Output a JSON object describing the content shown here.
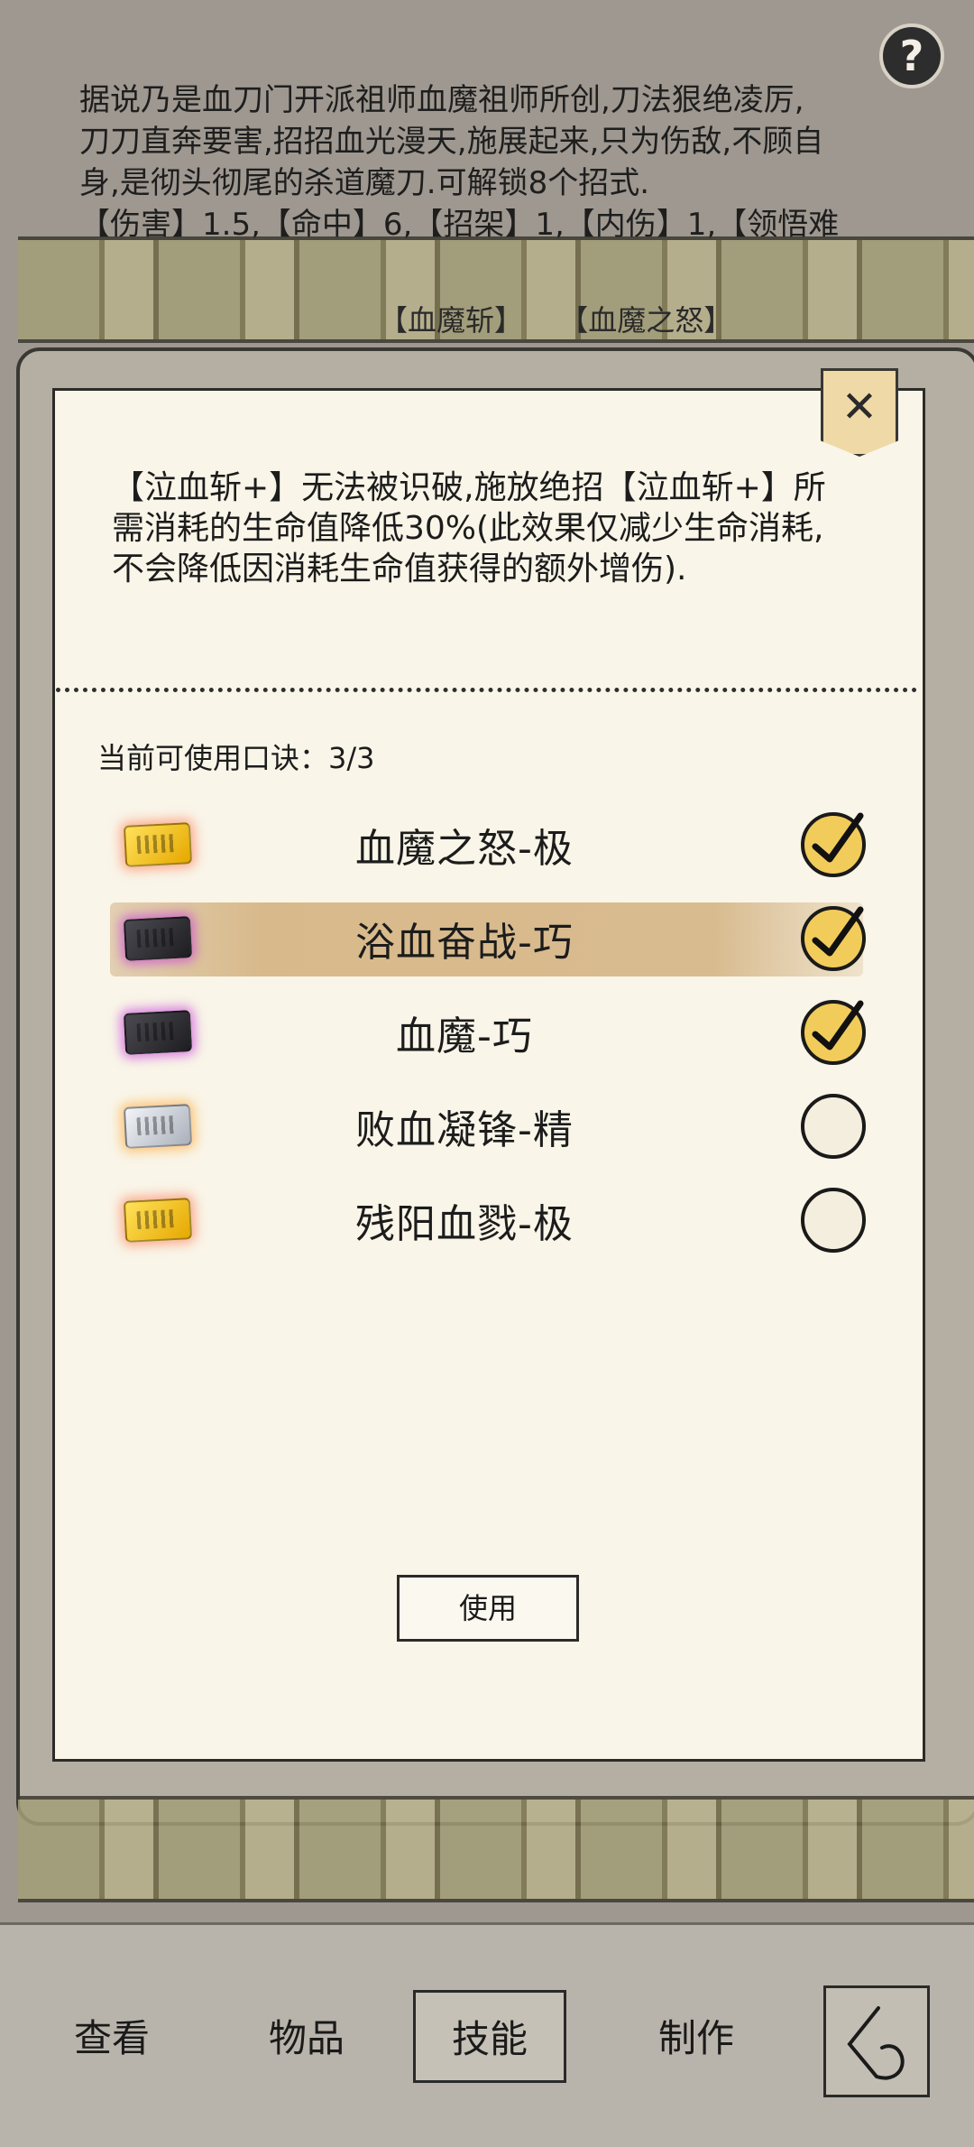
{
  "description": {
    "line1": "据说乃是血刀门开派祖师血魔祖师所创,刀法狠绝凌厉,",
    "line2": "刀刀直奔要害,招招血光漫天,施展起来,只为伤敌,不顾自",
    "line3": "身,是彻头彻尾的杀道魔刀.可解锁8个招式.",
    "line4": "【伤害】1.5,【命中】6,【招架】1,【内伤】1,【领悟难"
  },
  "help_label": "?",
  "hidden_skills": [
    "【血魔斩】",
    "【血魔之怒】"
  ],
  "popup": {
    "close_label": "✕",
    "effect_text": "【泣血斩+】无法被识破,施放绝招【泣血斩+】所需消耗的生命值降低30%(此效果仅减少生命消耗,不会降低因消耗生命值获得的额外增伤).",
    "usable_label": "当前可使用口诀：3/3",
    "items": [
      {
        "name": "血魔之怒-极",
        "token": "gold",
        "checked": true,
        "selected": false
      },
      {
        "name": "浴血奋战-巧",
        "token": "dark",
        "checked": true,
        "selected": true
      },
      {
        "name": "血魔-巧",
        "token": "dark",
        "checked": true,
        "selected": false
      },
      {
        "name": "败血凝锋-精",
        "token": "silver",
        "checked": false,
        "selected": false
      },
      {
        "name": "残阳血戮-极",
        "token": "gold",
        "checked": false,
        "selected": false
      }
    ],
    "use_button": "使用"
  },
  "nav": {
    "view": "查看",
    "items": "物品",
    "skills": "技能",
    "craft": "制作"
  }
}
